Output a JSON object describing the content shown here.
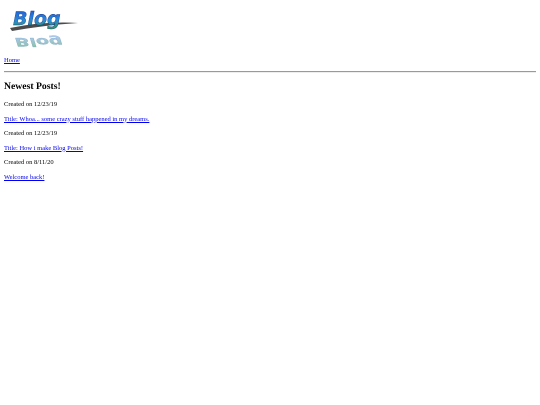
{
  "header": {
    "logo_text": "Blog",
    "home_label": "Home"
  },
  "main": {
    "heading": "Newest Posts!",
    "posts": [
      {
        "date": "Created on 12/23/19",
        "title": "Title: Whoa... some crazy stuff happened in my dreams."
      },
      {
        "date": "Created on 12/23/19",
        "title": "Title: How i make Blog Posts!"
      },
      {
        "date": "Created on 8/11/20",
        "title": "Welcome back!"
      }
    ]
  },
  "colors": {
    "link": "#0000ee",
    "logo_blue": "#1f5bd8",
    "logo_green": "#2f8f3a"
  }
}
